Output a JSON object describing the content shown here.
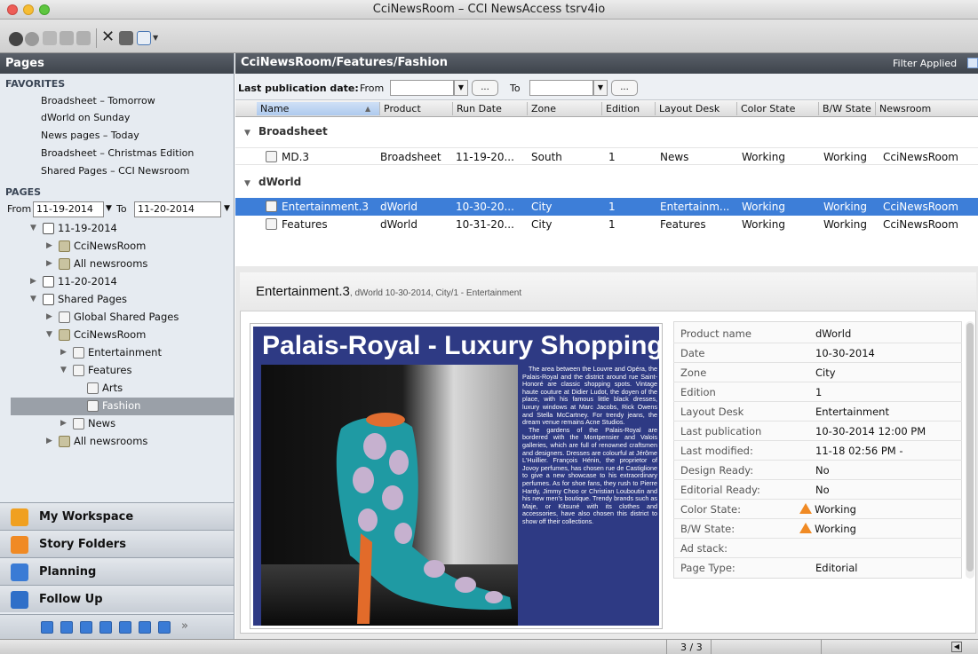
{
  "window": {
    "title": "CciNewsRoom – CCI NewsAccess tsrv4io"
  },
  "sidebar": {
    "header": "Pages",
    "favorites_label": "FAVORITES",
    "favorites": [
      "Broadsheet – Tomorrow",
      "dWorld on Sunday",
      "News pages – Today",
      "Broadsheet – Christmas Edition",
      "Shared Pages – CCI Newsroom"
    ],
    "pages_label": "PAGES",
    "from_label": "From",
    "from_value": "11-19-2014",
    "to_label": "To",
    "to_value": "11-20-2014",
    "tree": {
      "d1": "11-19-2014",
      "cci": "CciNewsRoom",
      "all1": "All newsrooms",
      "d2": "11-20-2014",
      "shared": "Shared Pages",
      "global": "Global Shared Pages",
      "cci2": "CciNewsRoom",
      "ent": "Entertainment",
      "features": "Features",
      "arts": "Arts",
      "fashion": "Fashion",
      "news": "News",
      "all2": "All newsrooms"
    },
    "nav": [
      "My Workspace",
      "Story Folders",
      "Planning",
      "Follow Up"
    ],
    "more": "»"
  },
  "main": {
    "breadcrumb": "CciNewsRoom/Features/Fashion",
    "filter_status": "Filter Applied",
    "filter": {
      "label": "Last publication date:",
      "from": "From",
      "to": "To",
      "dots": "..."
    },
    "columns": [
      "Name",
      "Product",
      "Run Date",
      "Zone",
      "Edition",
      "Layout Desk",
      "Color State",
      "B/W State",
      "Newsroom"
    ],
    "groups": [
      "Broadsheet",
      "dWorld"
    ],
    "rows": [
      {
        "name": "MD.3",
        "product": "Broadsheet",
        "run": "11-19-20...",
        "zone": "South",
        "edition": "1",
        "desk": "News",
        "color": "Working",
        "bw": "Working",
        "newsroom": "CciNewsRoom"
      },
      {
        "name": "Entertainment.3",
        "product": "dWorld",
        "run": "10-30-20...",
        "zone": "City",
        "edition": "1",
        "desk": "Entertainm...",
        "color": "Working",
        "bw": "Working",
        "newsroom": "CciNewsRoom"
      },
      {
        "name": "Features",
        "product": "dWorld",
        "run": "10-31-20...",
        "zone": "City",
        "edition": "1",
        "desk": "Features",
        "color": "Working",
        "bw": "Working",
        "newsroom": "CciNewsRoom"
      }
    ]
  },
  "preview": {
    "title": "Entertainment.3",
    "subtitle": ", dWorld 10-30-2014, City/1 - Entertainment",
    "headline": "Palais-Royal - Luxury Shopping",
    "para1": "The area between the Louvre and Opéra, the Palais-Royal and the district around rue Saint-Honoré are classic shopping spots. Vintage haute couture at Didier Ludot, the doyen of the place, with his famous little black dresses, luxury windows at Marc Jacobs, Rick Owens and Stella McCartney. For trendy jeans, the dream venue remains Acne Studios.",
    "para2": "The gardens of the Palais-Royal are bordered with the Montpensier and Valois galleries, which are full of renowned craftsmen and designers. Dresses are colourful at Jérôme L'Huillier. François Hénin, the proprietor of Jovoy perfumes, has chosen rue de Castiglione to give a new showcase to his extraordinary perfumes. As for shoe fans, they rush to Pierre Hardy, Jimmy Choo or Christian Louboutin and his new men's boutique. Trendy brands such as Maje, or Kitsuné with its clothes and accessories, have also chosen this district to show off their collections."
  },
  "props": [
    {
      "label": "Product name",
      "value": "dWorld"
    },
    {
      "label": "Date",
      "value": "10-30-2014"
    },
    {
      "label": "Zone",
      "value": "City"
    },
    {
      "label": "Edition",
      "value": "1"
    },
    {
      "label": "Layout Desk",
      "value": "Entertainment"
    },
    {
      "label": "Last publication",
      "value": "10-30-2014 12:00 PM"
    },
    {
      "label": "Last modified:",
      "value": "11-18 02:56 PM -"
    },
    {
      "label": "Design Ready:",
      "value": "No"
    },
    {
      "label": "Editorial Ready:",
      "value": "No"
    },
    {
      "label": "Color State:",
      "value": "Working"
    },
    {
      "label": "B/W State:",
      "value": "Working"
    },
    {
      "label": "Ad stack:",
      "value": ""
    },
    {
      "label": "Page Type:",
      "value": "Editorial"
    }
  ],
  "status": {
    "page": "3 / 3"
  },
  "colors": {
    "selection": "#3d7ed8",
    "header": "#4a5058",
    "warning": "#f08a24",
    "page_bg": "#2e3a84"
  }
}
